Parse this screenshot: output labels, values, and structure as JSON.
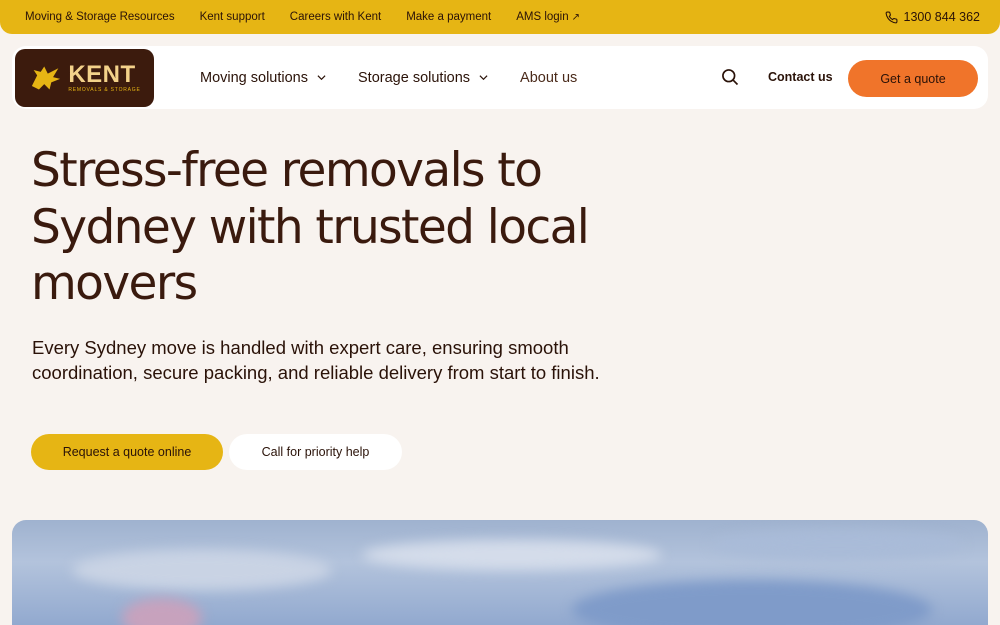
{
  "topbar": {
    "links": [
      "Moving & Storage Resources",
      "Kent support",
      "Careers with Kent",
      "Make a payment",
      "AMS login"
    ],
    "ams_arrow": "↗",
    "phone": "1300 844 362",
    "phone_icon": "phone-icon"
  },
  "logo": {
    "name": "KENT",
    "tagline": "REMOVALS & STORAGE",
    "icon": "griffin-icon"
  },
  "nav": {
    "items": [
      {
        "label": "Moving solutions",
        "has_dropdown": true
      },
      {
        "label": "Storage solutions",
        "has_dropdown": true
      },
      {
        "label": "About us",
        "has_dropdown": false
      }
    ],
    "search_icon": "search-icon",
    "contact_label": "Contact us",
    "quote_label": "Get a quote"
  },
  "hero": {
    "title": "Stress-free removals to Sydney with trusted local movers",
    "subtitle": "Every Sydney move is handled with expert care, ensuring smooth coordination, secure packing, and reliable delivery from start to finish.",
    "primary_cta": "Request a quote online",
    "secondary_cta": "Call for priority help"
  },
  "colors": {
    "accent_yellow": "#e6b514",
    "accent_orange": "#f0742a",
    "brand_brown": "#3c1b0d",
    "background": "#f8f3ef"
  }
}
